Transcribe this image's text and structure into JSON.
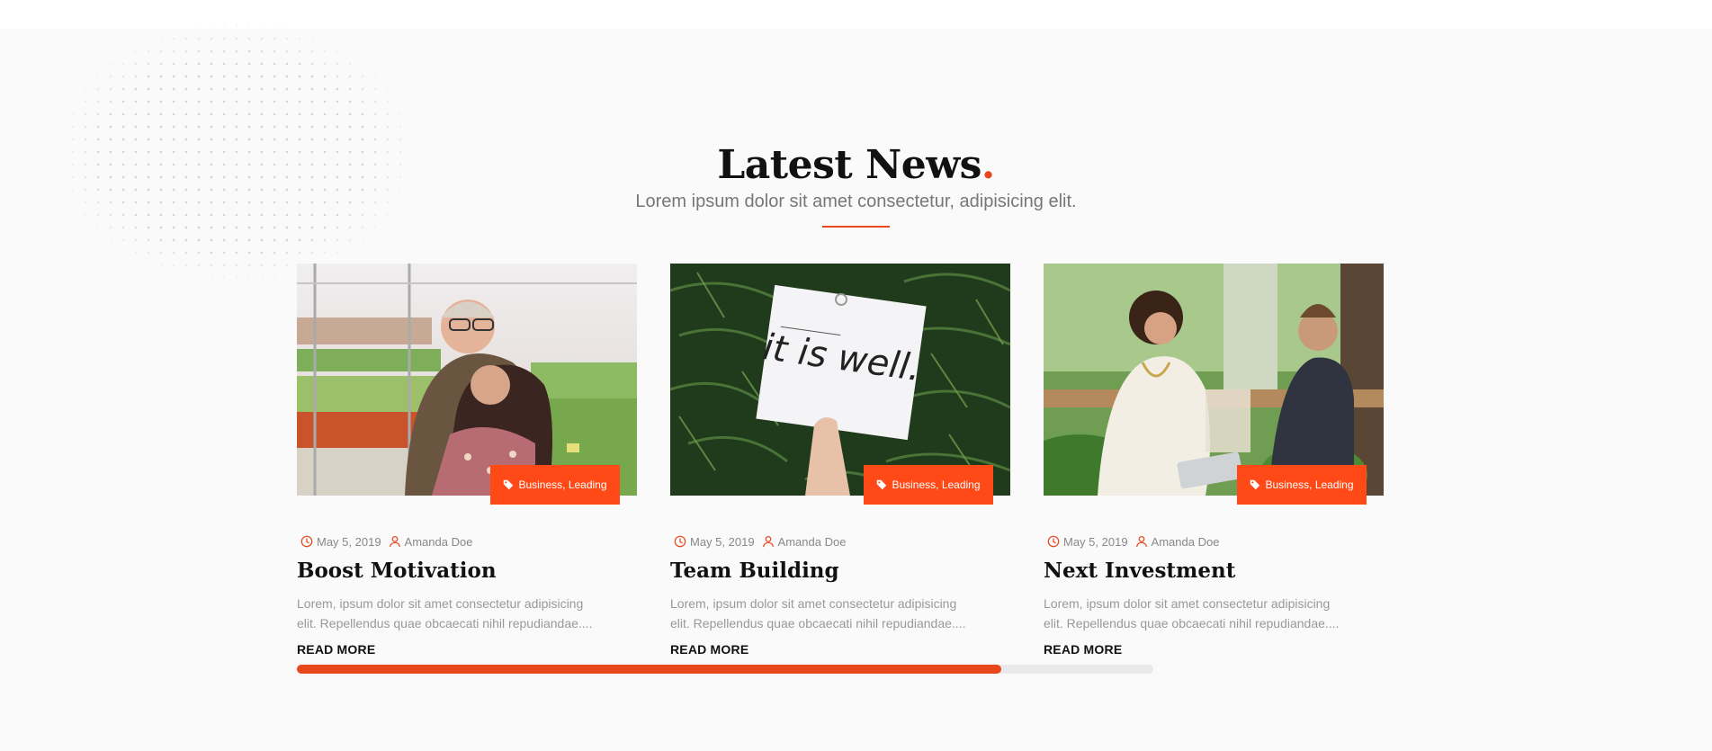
{
  "section": {
    "title": "Latest News",
    "title_dot": ".",
    "subtitle": "Lorem ipsum dolor sit amet consectetur, adipisicing elit."
  },
  "colors": {
    "accent": "#e8471c",
    "tag_bg": "#ff4a17"
  },
  "posts": [
    {
      "tag_icon": "tag-icon",
      "tags": "Business, Leading",
      "date": "May 5, 2019",
      "author": "Amanda Doe",
      "title": "Boost Motivation",
      "excerpt": "Lorem, ipsum dolor sit amet consectetur adipisicing elit. Repellendus quae obcaecati nihil repudiandae....",
      "read_more": "READ MORE"
    },
    {
      "tag_icon": "tag-icon",
      "tags": "Business, Leading",
      "date": "May 5, 2019",
      "author": "Amanda Doe",
      "title": "Team Building",
      "excerpt": "Lorem, ipsum dolor sit amet consectetur adipisicing elit. Repellendus quae obcaecati nihil repudiandae....",
      "read_more": "READ MORE",
      "image_text": "it is well."
    },
    {
      "tag_icon": "tag-icon",
      "tags": "Business, Leading",
      "date": "May 5, 2019",
      "author": "Amanda Doe",
      "title": "Next Investment",
      "excerpt": "Lorem, ipsum dolor sit amet consectetur adipisicing elit. Repellendus quae obcaecati nihil repudiandae....",
      "read_more": "READ MORE"
    }
  ],
  "carousel": {
    "progress": 0.823
  }
}
